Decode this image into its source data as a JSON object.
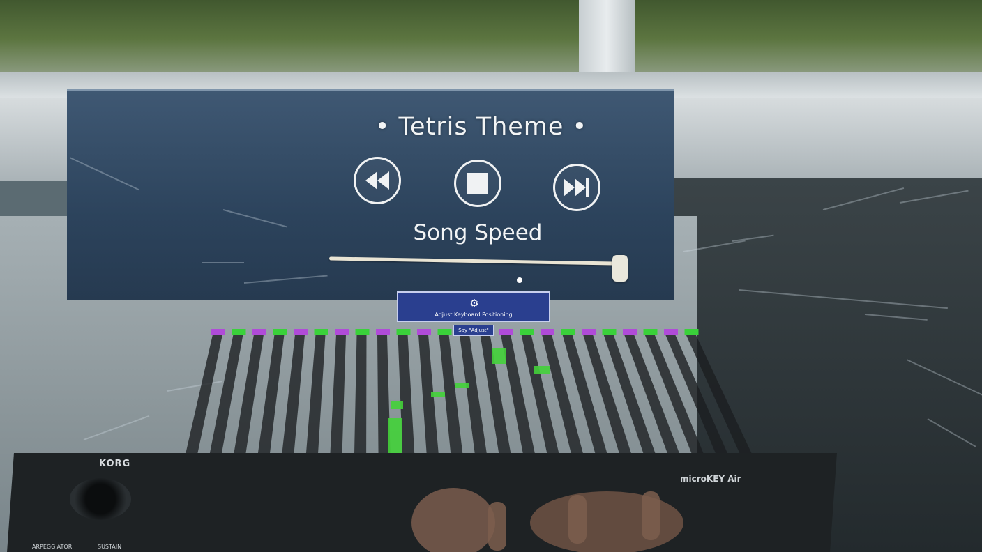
{
  "player": {
    "title": "• Tetris Theme •",
    "rewind_icon": "rewind-icon",
    "stop_icon": "stop-icon",
    "fast_forward_icon": "fast-forward-icon",
    "speed_label": "Song Speed",
    "speed_level": 1.0
  },
  "adjust_button": {
    "icon": "gear-icon",
    "label": "Adjust Keyboard Positioning",
    "voice_hint": "Say \"Adjust\""
  },
  "keyboard": {
    "brand": "KORG",
    "model": "microKEY Air",
    "arpeggiator_label": "ARPEGGIATOR",
    "sustain_label": "SUSTAIN"
  },
  "colors": {
    "panel_text": "#f2f4f5",
    "button_bg": "#2a3f8f",
    "note_green": "#44d13a",
    "key_marker_purple": "#b04bd8",
    "key_marker_green": "#3ad13a"
  }
}
